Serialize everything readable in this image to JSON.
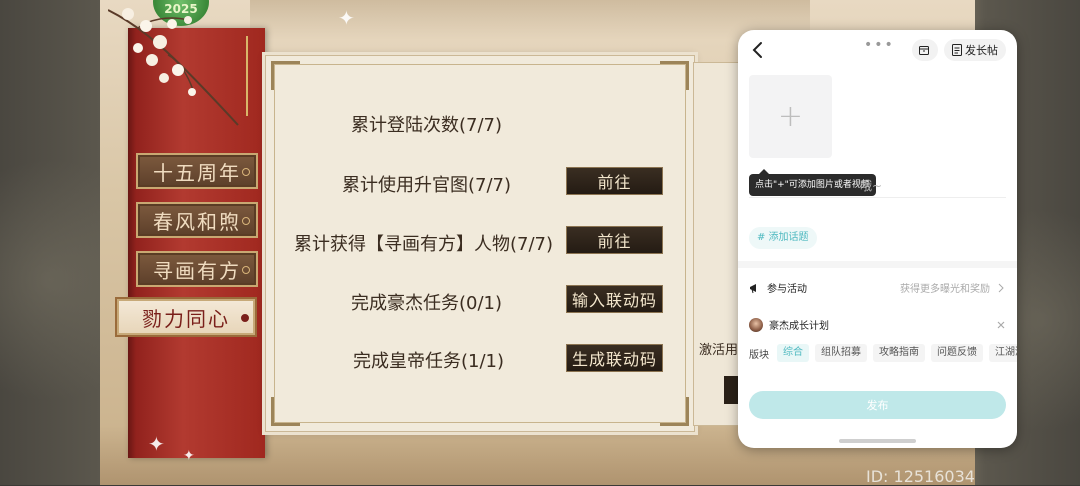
{
  "game": {
    "logo_text": "2025",
    "tabs": [
      {
        "label": "十五周年"
      },
      {
        "label": "春风和煦"
      },
      {
        "label": "寻画有方"
      },
      {
        "label": "勠力同心",
        "active": true
      }
    ],
    "tasks": [
      {
        "label": "累计登陆次数(7/7)",
        "button": ""
      },
      {
        "label": "累计使用升官图(7/7)",
        "button": "前往"
      },
      {
        "label": "累计获得【寻画有方】人物(7/7)",
        "button": "前往"
      },
      {
        "label": "完成豪杰任务(0/1)",
        "button": "输入联动码"
      },
      {
        "label": "完成皇帝任务(1/1)",
        "button": "生成联动码"
      }
    ],
    "side_text": "激活用户",
    "id_text": "ID: 12516034"
  },
  "post_overlay": {
    "more_dots": "•••",
    "long_post_label": "发长帖",
    "add_media_tooltip": "点击\"+\"可添加图片或者视频",
    "title_placeholder_tail": "哦~",
    "add_topic_label": "# 添加话题",
    "activity": {
      "label": "参与活动",
      "hint": "获得更多曝光和奖励"
    },
    "plan": {
      "label": "豪杰成长计划"
    },
    "category": {
      "label": "版块",
      "chips": [
        "综合",
        "组队招募",
        "攻略指南",
        "问题反馈",
        "江湖酒"
      ],
      "selected": "综合"
    },
    "publish_label": "发布"
  },
  "colors": {
    "accent_teal": "#4fb9c0",
    "publish_disabled": "#bfe8e9",
    "scroll_red": "#a0281f",
    "dark_button": "#2a2118"
  }
}
